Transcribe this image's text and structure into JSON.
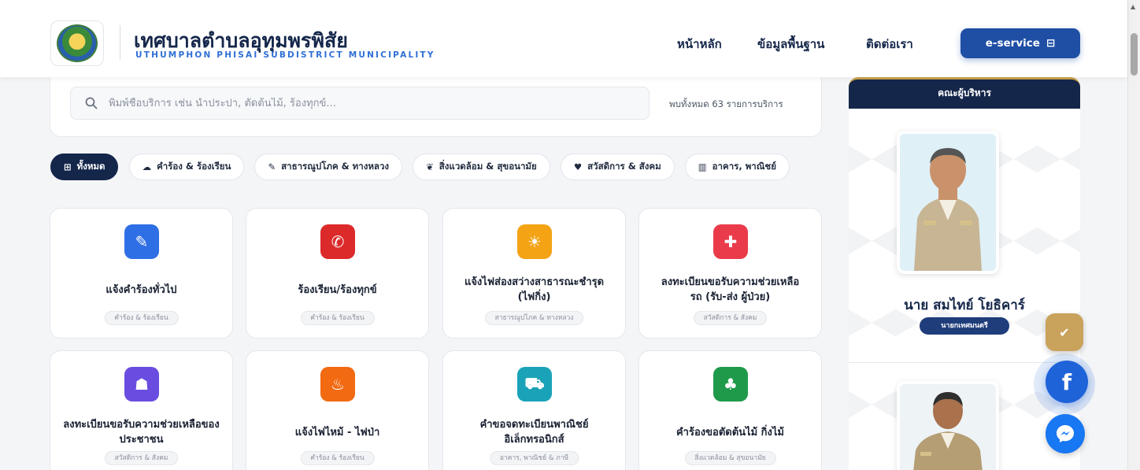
{
  "header": {
    "brand_th": "เทศบาลตำบลอุทุมพรพิสัย",
    "brand_en": "UTHUMPHON PHISAI SUBDISTRICT MUNICIPALITY",
    "nav": {
      "home": "หน้าหลัก",
      "info": "ข้อมูลพื้นฐาน",
      "contact": "ติดต่อเรา"
    },
    "eservice_label": "e-service",
    "eservice_icon": "⊟"
  },
  "search": {
    "placeholder": "พิมพ์ชื่อบริการ เช่น น้ำประปา, ตัดต้นไม้, ร้องทุกข์...",
    "value": "",
    "count_text": "พบทั้งหมด 63 รายการบริการ"
  },
  "chips": [
    {
      "icon": "⊞",
      "label": "ทั้งหมด"
    },
    {
      "icon": "☁",
      "label": "คำร้อง & ร้องเรียน"
    },
    {
      "icon": "✎",
      "label": "สาธารณูปโภค & ทางหลวง"
    },
    {
      "icon": "❦",
      "label": "สิ่งแวดล้อม & สุขอนามัย"
    },
    {
      "icon": "♥",
      "label": "สวัสดิการ & สังคม"
    },
    {
      "icon": "▥",
      "label": "อาคาร, พาณิชย์"
    }
  ],
  "cards": [
    {
      "icon": "✎",
      "color": "#2f6fe6",
      "title": "แจ้งคำร้องทั่วไป",
      "tag": "คำร้อง & ร้องเรียน"
    },
    {
      "icon": "✆",
      "color": "#dc2a2a",
      "title": "ร้องเรียน/ร้องทุกข์",
      "tag": "คำร้อง & ร้องเรียน"
    },
    {
      "icon": "☀",
      "color": "#f4a315",
      "title": "แจ้งไฟส่องสว่างสาธารณะชำรุด (ไฟกิ่ง)",
      "tag": "สาธารณูปโภค & ทางหลวง"
    },
    {
      "icon": "✚",
      "color": "#ea3b4b",
      "title": "ลงทะเบียนขอรับความช่วยเหลือ รถ (รับ-ส่ง ผู้ป่วย)",
      "tag": "สวัสดิการ & สังคม"
    },
    {
      "icon": "☗",
      "color": "#6a4de0",
      "title": "ลงทะเบียนขอรับความช่วยเหลือของประชาชน",
      "tag": "สวัสดิการ & สังคม"
    },
    {
      "icon": "♨",
      "color": "#f26a12",
      "title": "แจ้งไฟไหม้ - ไฟป่า",
      "tag": "คำร้อง & ร้องเรียน"
    },
    {
      "icon": "⛟",
      "color": "#1aa3b8",
      "title": "คำขอจดทะเบียนพาณิชย์อิเล็กทรอนิกส์",
      "tag": "อาคาร, พาณิชย์ & ภาษี"
    },
    {
      "icon": "♣",
      "color": "#1f9a4a",
      "title": "คำร้องขอตัดต้นไม้ กิ่งไม้",
      "tag": "สิ่งแวดล้อม & สุขอนามัย"
    }
  ],
  "executives": {
    "heading": "คณะผู้บริหาร",
    "name": "นาย สมไทย์ โยธิคาร์",
    "position": "นายกเทศมนตรี"
  },
  "fabs": {
    "form_icon": "✔",
    "facebook_icon": "f",
    "messenger_icon": "⚡"
  },
  "icons": {
    "search": "search-icon",
    "scroll_up": "▲"
  }
}
